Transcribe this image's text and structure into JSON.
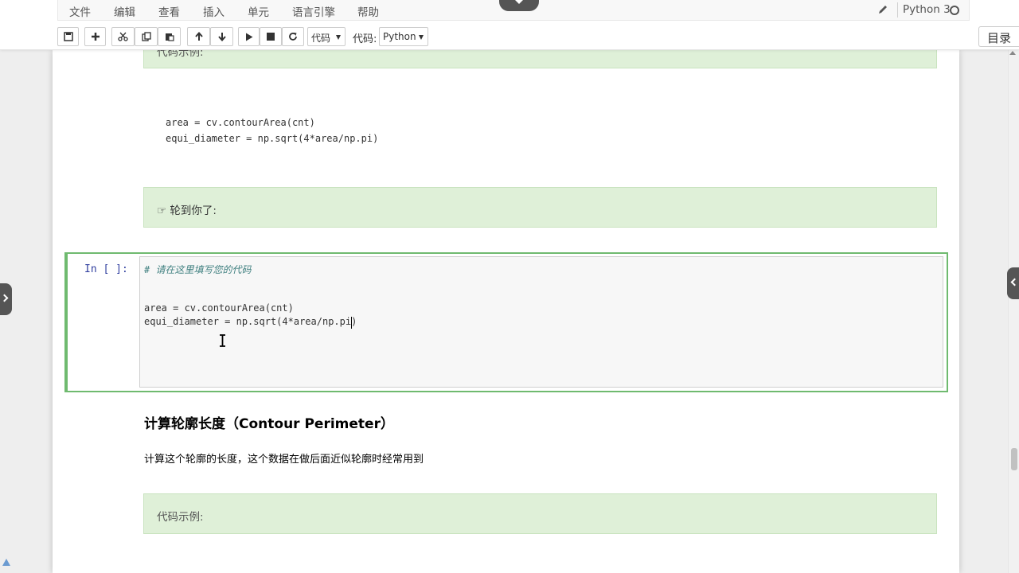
{
  "menubar": {
    "items": [
      "文件",
      "编辑",
      "查看",
      "插入",
      "单元",
      "语言引擎",
      "帮助"
    ],
    "kernel_name": "Python 3"
  },
  "toolbar": {
    "cell_type_value": "代码",
    "celltype_label": "代码:",
    "language_value": "Python",
    "toc_label": "目录"
  },
  "notebook": {
    "top_box_text": "代码示例:",
    "code1_line1": "area = cv.contourArea(cnt)",
    "code1_line2": "equi_diameter = np.sqrt(4*area/np.pi)",
    "turn_box_text": "☞ 轮到你了:",
    "active_cell": {
      "prompt": "In [ ]:",
      "comment": "# 请在这里填写您的代码",
      "line1": "area = cv.contourArea(cnt)",
      "line2": "equi_diameter = np.sqrt(4*area/np.pi)"
    },
    "heading_perimeter": "计算轮廓长度（Contour Perimeter）",
    "paragraph_perimeter": "计算这个轮廓的长度，这个数据在做后面近似轮廓时经常用到",
    "bottom_box_text": "代码示例:"
  }
}
